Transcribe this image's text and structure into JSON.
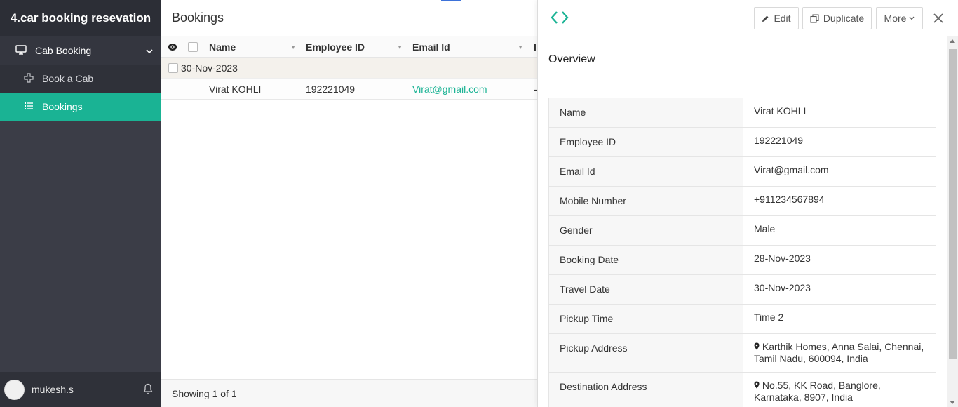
{
  "app": {
    "title": "4.car booking resevation"
  },
  "sidebar": {
    "section": {
      "label": "Cab Booking",
      "icon": "monitor-icon"
    },
    "items": [
      {
        "label": "Book a Cab",
        "icon": "plus-icon",
        "active": false
      },
      {
        "label": "Bookings",
        "icon": "list-icon",
        "active": true
      }
    ],
    "user": {
      "name": "mukesh.s"
    }
  },
  "main": {
    "title": "Bookings",
    "columns": [
      "Name",
      "Employee ID",
      "Email Id",
      "I"
    ],
    "group": {
      "label": "30-Nov-2023"
    },
    "rows": [
      {
        "name": "Virat KOHLI",
        "employee_id": "192221049",
        "email": "Virat@gmail.com",
        "more": "-"
      }
    ],
    "footer": "Showing 1 of 1"
  },
  "panel": {
    "buttons": {
      "edit": "Edit",
      "duplicate": "Duplicate",
      "more": "More"
    },
    "overview_title": "Overview",
    "fields": [
      {
        "label": "Name",
        "value": "Virat KOHLI"
      },
      {
        "label": "Employee ID",
        "value": "192221049"
      },
      {
        "label": "Email Id",
        "value": "Virat@gmail.com",
        "link": true
      },
      {
        "label": "Mobile Number",
        "value": "+911234567894"
      },
      {
        "label": "Gender",
        "value": "Male"
      },
      {
        "label": "Booking Date",
        "value": "28-Nov-2023"
      },
      {
        "label": "Travel Date",
        "value": "30-Nov-2023"
      },
      {
        "label": "Pickup Time",
        "value": "Time 2"
      },
      {
        "label": "Pickup Address",
        "value": "Karthik Homes, Anna Salai, Chennai, Tamil Nadu, 600094, India",
        "pin": true
      },
      {
        "label": "Destination Address",
        "value": "No.55, KK Road, Banglore, Karnataka, 8907, India",
        "pin": true
      }
    ]
  },
  "colors": {
    "accent": "#1ab394",
    "sidebar": "#3b3d47",
    "sidebar_dark": "#2c2e36"
  }
}
